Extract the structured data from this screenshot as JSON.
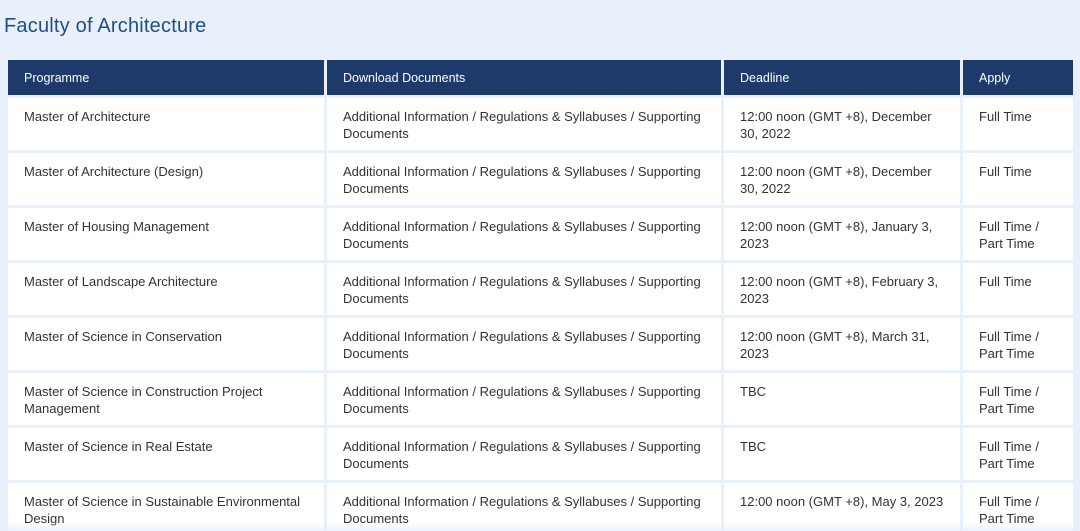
{
  "faculty": {
    "title": "Faculty of Architecture"
  },
  "table": {
    "headers": {
      "programme": "Programme",
      "documents": "Download Documents",
      "deadline": "Deadline",
      "apply": "Apply"
    },
    "rows": [
      {
        "programme": "Master of Architecture",
        "documents": "Additional Information / Regulations & Syllabuses / Supporting Documents",
        "deadline": "12:00 noon (GMT +8), December 30, 2022",
        "apply": "Full Time"
      },
      {
        "programme": "Master of Architecture (Design)",
        "documents": "Additional Information / Regulations & Syllabuses / Supporting Documents",
        "deadline": "12:00 noon (GMT +8), December 30, 2022",
        "apply": "Full Time"
      },
      {
        "programme": "Master of Housing Management",
        "documents": "Additional Information / Regulations & Syllabuses / Supporting Documents",
        "deadline": "12:00 noon (GMT +8), January 3, 2023",
        "apply": "Full Time / Part Time"
      },
      {
        "programme": "Master of Landscape Architecture",
        "documents": "Additional Information / Regulations & Syllabuses / Supporting Documents",
        "deadline": "12:00 noon (GMT +8), February 3, 2023",
        "apply": "Full Time"
      },
      {
        "programme": "Master of Science in Conservation",
        "documents": "Additional Information / Regulations & Syllabuses / Supporting Documents",
        "deadline": "12:00 noon (GMT +8), March 31, 2023",
        "apply": "Full Time / Part Time"
      },
      {
        "programme": "Master of Science in Construction Project Management",
        "documents": "Additional Information / Regulations & Syllabuses / Supporting Documents",
        "deadline": "TBC",
        "apply": "Full Time / Part Time"
      },
      {
        "programme": "Master of Science in Real Estate",
        "documents": "Additional Information / Regulations & Syllabuses / Supporting Documents",
        "deadline": "TBC",
        "apply": "Full Time / Part Time"
      },
      {
        "programme": "Master of Science in Sustainable Environmental Design",
        "documents": "Additional Information / Regulations & Syllabuses / Supporting Documents",
        "deadline": "12:00 noon (GMT +8), May 3, 2023",
        "apply": "Full Time / Part Time"
      }
    ]
  }
}
